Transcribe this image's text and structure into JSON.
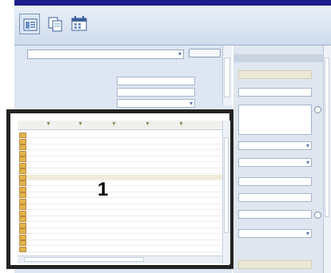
{
  "toolbar": {
    "buttons": [
      {
        "icon": "grid-view-icon",
        "selected": true
      },
      {
        "icon": "copy-pages-icon",
        "selected": false
      },
      {
        "icon": "table-calendar-icon",
        "selected": false
      }
    ]
  },
  "callout": {
    "number": "1"
  },
  "grid": {
    "columns": 5,
    "rows": 20,
    "selected_row_index": 7
  },
  "colors": {
    "titlebar": "#1d1d8c",
    "panel": "#dde6f2",
    "frame": "#232323",
    "selected_row": "#f0ecd8",
    "folder": "#e3b34c"
  }
}
